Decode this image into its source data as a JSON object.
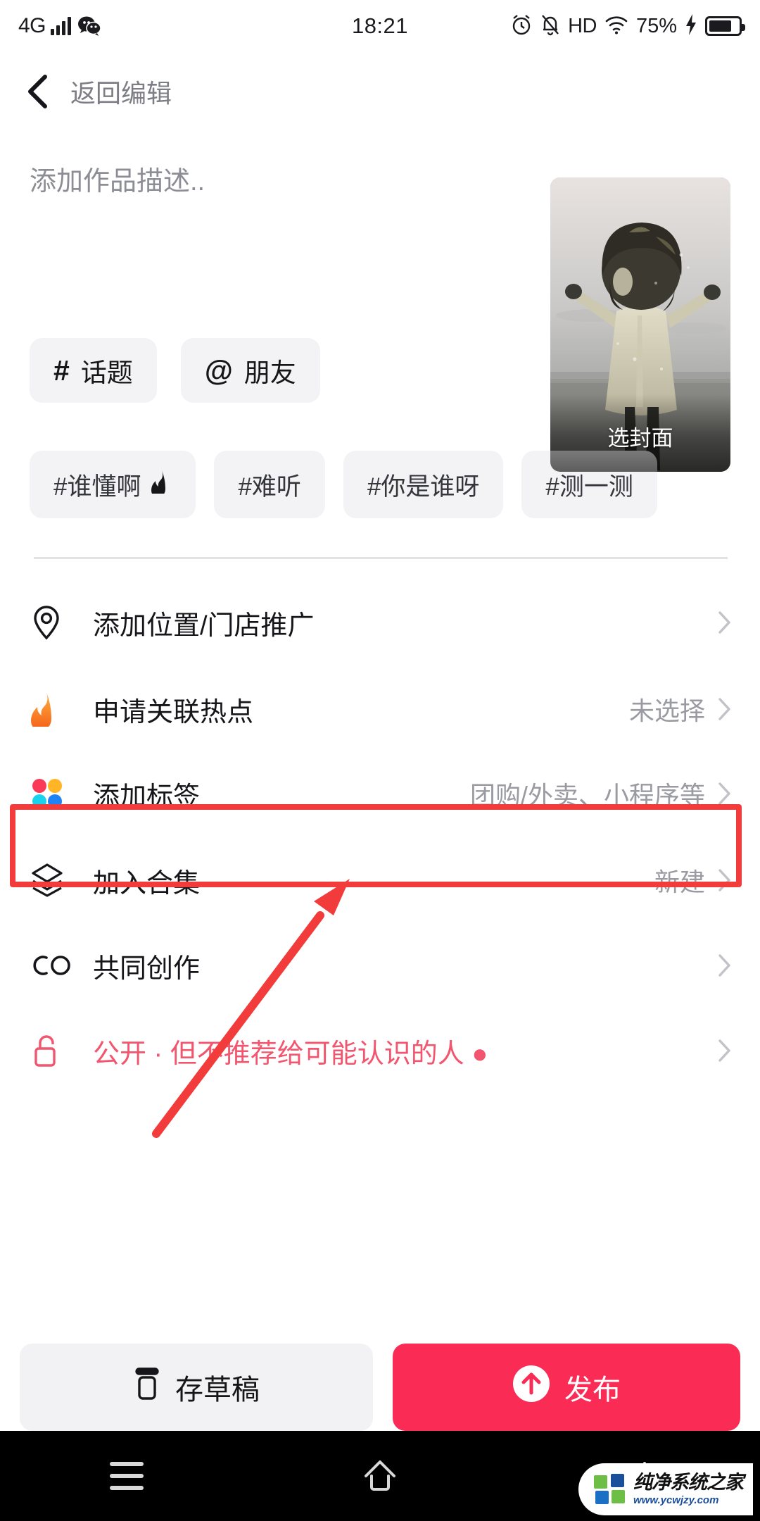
{
  "status_bar": {
    "network": "4G",
    "signal_icon": "signal-bars-icon",
    "app_icon": "wechat-icon",
    "time": "18:21",
    "alarm_icon": "alarm-clock-icon",
    "mute_icon": "bell-muted-icon",
    "hd": "HD",
    "wifi_icon": "wifi-icon",
    "battery_percent": "75%",
    "charging_icon": "charging-bolt-icon",
    "battery_icon": "battery-icon"
  },
  "nav": {
    "back_icon": "back-chevron-icon",
    "title": "返回编辑"
  },
  "description": {
    "placeholder": "添加作品描述..",
    "value": ""
  },
  "cover": {
    "label": "选封面"
  },
  "quick_actions": [
    {
      "symbol": "#",
      "label": "话题",
      "icon": "hash-icon"
    },
    {
      "symbol": "@",
      "label": "朋友",
      "icon": "at-icon"
    }
  ],
  "hashtag_suggestions": [
    {
      "label": "#谁懂啊",
      "badge": "flame-icon"
    },
    {
      "label": "#难听",
      "badge": ""
    },
    {
      "label": "#你是谁呀",
      "badge": ""
    },
    {
      "label": "#测一测",
      "badge": ""
    }
  ],
  "rows": [
    {
      "icon": "location-pin-icon",
      "label": "添加位置/门店推广",
      "value": "",
      "chevron": "chevron-right-icon"
    },
    {
      "icon": "flame-icon",
      "label": "申请关联热点",
      "value": "未选择",
      "chevron": "chevron-right-icon"
    },
    {
      "icon": "four-dots-icon",
      "label": "添加标签",
      "value": "团购/外卖、小程序等",
      "chevron": "chevron-right-icon"
    },
    {
      "icon": "layers-icon",
      "label": "加入合集",
      "value": "新建",
      "chevron": "chevron-right-icon"
    },
    {
      "icon": "co-create-icon",
      "label": "共同创作",
      "value": "",
      "chevron": "chevron-right-icon"
    },
    {
      "icon": "unlock-icon",
      "label": "公开 · 但不推荐给可能认识的人 ●",
      "value": "",
      "chevron": "chevron-right-icon"
    }
  ],
  "actions": {
    "draft_label": "存草稿",
    "draft_icon": "draft-jar-icon",
    "publish_label": "发布",
    "publish_icon": "arrow-up-circle-icon"
  },
  "android_nav": {
    "menu_icon": "menu-icon",
    "home_icon": "home-icon",
    "back_icon": "back-arrow-icon"
  },
  "watermark": {
    "title": "纯净系统之家",
    "url": "www.ycwjzy.com"
  },
  "annotation": {
    "highlight_color": "#f23b3b",
    "arrow_color": "#f23b3b",
    "target": "添加标签"
  },
  "colors": {
    "accent_red": "#fa2c55",
    "privacy_pink": "#f2556e",
    "chip_bg": "#f3f3f5",
    "muted_text": "#9a9aa2"
  }
}
